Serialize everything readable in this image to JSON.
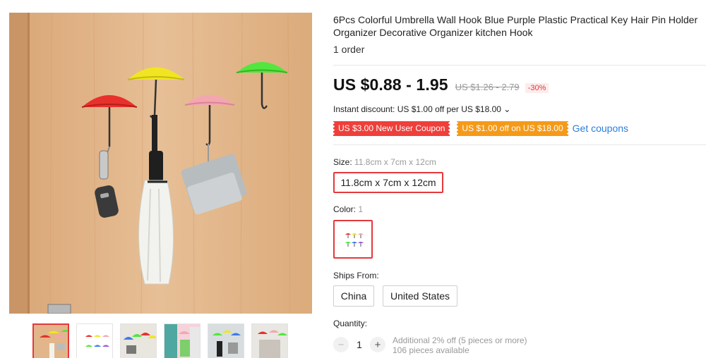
{
  "product": {
    "title": "6Pcs Colorful Umbrella Wall Hook Blue Purple Plastic Practical Key Hair Pin Holder Organizer Decorative Organizer kitchen Hook",
    "orders": "1 order"
  },
  "pricing": {
    "price": "US $0.88 - 1.95",
    "original_price": "US $1.26 - 2.79",
    "discount": "-30%",
    "instant_discount": "Instant discount: US $1.00 off per US $18.00 ⌄"
  },
  "coupons": {
    "new_user": "US $3.00 New User Coupon",
    "store": "US $1.00 off on US $18.00",
    "get_link": "Get coupons",
    "red_color": "#ef3f3a",
    "orange_color": "#f59a18"
  },
  "size": {
    "label": "Size: ",
    "selected_value": "11.8cm x 7cm x 12cm",
    "options": [
      "11.8cm x 7cm x 12cm"
    ]
  },
  "color": {
    "label": "Color: ",
    "selected_value": "1"
  },
  "shipping": {
    "label": "Ships From:",
    "options": [
      "China",
      "United States"
    ]
  },
  "quantity": {
    "label": "Quantity:",
    "value": "1",
    "minus": "−",
    "plus": "+",
    "note_1": "Additional 2% off (5 pieces or more)",
    "note_2": "106 pieces available"
  },
  "gallery": {
    "thumbnail_count": 6,
    "active_index": 0
  },
  "colors": {
    "accent_red": "#e4393c",
    "link_blue": "#2b7ed8"
  }
}
